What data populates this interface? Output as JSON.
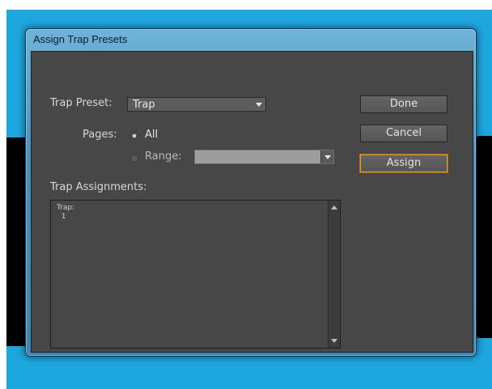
{
  "dialog": {
    "title": "Assign Trap Presets",
    "trap_preset_label": "Trap Preset:",
    "trap_preset_value": "Trap",
    "pages_label": "Pages:",
    "all_label": "All",
    "range_label": "Range:",
    "range_value": "",
    "pages_selected": "All",
    "assignments_label": "Trap Assignments:",
    "assignments_text": "Trap:\n  1"
  },
  "buttons": {
    "done": "Done",
    "cancel": "Cancel",
    "assign": "Assign"
  },
  "icons": {
    "dropdown": "chevron-down-icon",
    "scroll_up": "scroll-up-icon",
    "scroll_down": "scroll-down-icon"
  },
  "colors": {
    "desktop": "#1ea7df",
    "panel": "#474747",
    "focus_ring": "#e59a2f"
  }
}
